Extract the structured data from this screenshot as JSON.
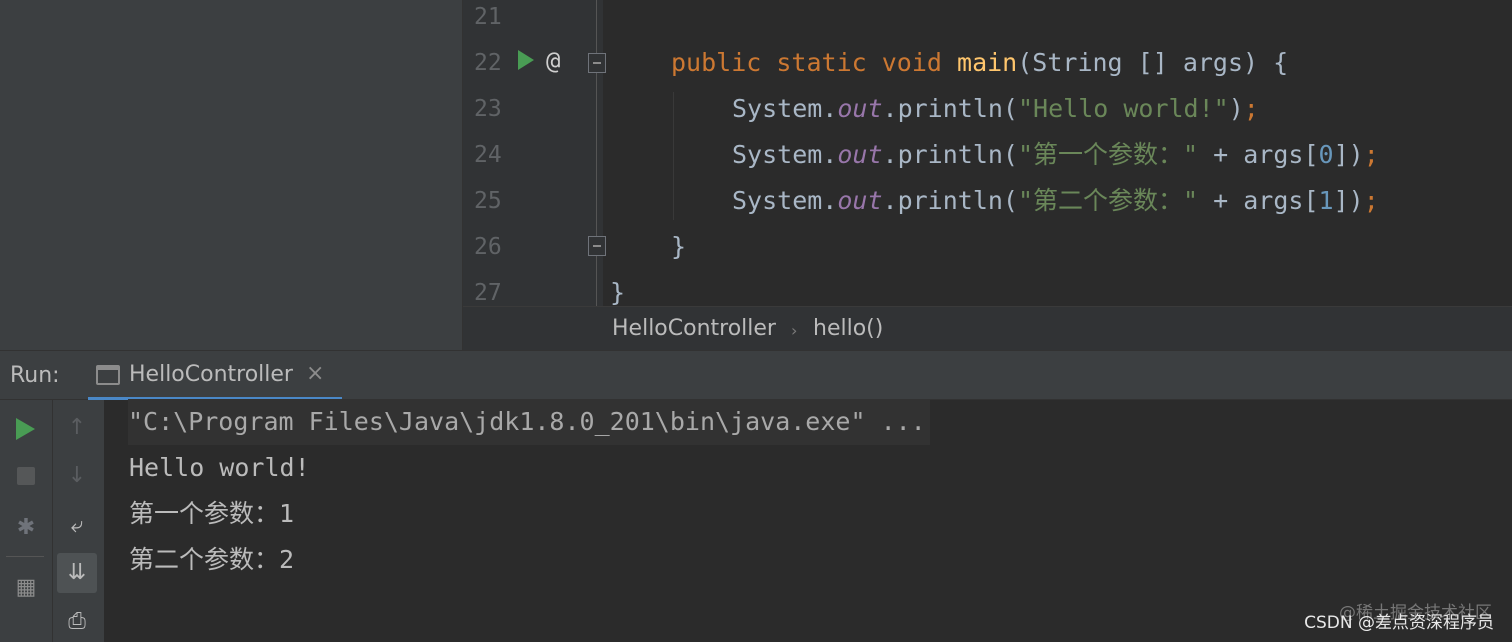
{
  "editor": {
    "line_numbers": [
      "21",
      "22",
      "23",
      "24",
      "25",
      "26",
      "27"
    ],
    "code": {
      "line22": {
        "kw1": "public",
        "kw2": "static",
        "kw3": "void",
        "fn": "main",
        "rest": "(String [] args) {"
      },
      "line23": {
        "cls": "System.",
        "field": "out",
        "call": ".println(",
        "str": "\"Hello world!\"",
        "close": ")",
        "semi": ";"
      },
      "line24": {
        "cls": "System.",
        "field": "out",
        "call": ".println(",
        "str": "\"第一个参数：\"",
        "op": " + args[",
        "idx": "0",
        "close": "])",
        "semi": ";"
      },
      "line25": {
        "cls": "System.",
        "field": "out",
        "call": ".println(",
        "str": "\"第二个参数：\"",
        "op": " + args[",
        "idx": "1",
        "close": "])",
        "semi": ";"
      },
      "line26": "}",
      "line27": "}"
    },
    "gutter_at": "@"
  },
  "breadcrumb": {
    "class": "HelloController",
    "separator": "›",
    "method": "hello()"
  },
  "run_window": {
    "label": "Run:",
    "tab_label": "HelloController",
    "tab_close": "×"
  },
  "toolbar": {
    "up_arrow": "↑",
    "down_arrow": "↓",
    "wrap": "⤶",
    "scroll_end": "⇊",
    "layout": "▦",
    "print": "⎙",
    "debug": "✱"
  },
  "console": {
    "lines": [
      "\"C:\\Program Files\\Java\\jdk1.8.0_201\\bin\\java.exe\" ...",
      "Hello world!",
      "第一个参数：1",
      "第二个参数：2"
    ]
  },
  "watermark": {
    "line1": "@稀土掘金技术社区",
    "line2": "CSDN @差点资深程序员"
  }
}
